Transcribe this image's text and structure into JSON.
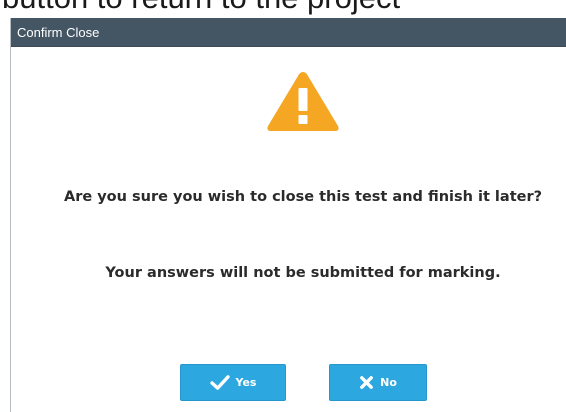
{
  "background_page": {
    "partial_text": "button to return to the project"
  },
  "dialog": {
    "title": "Confirm Close",
    "icon": "warning-icon",
    "message_primary": "Are you sure you wish to close this test and finish it later?",
    "message_secondary": "Your answers will not be submitted for marking.",
    "buttons": {
      "yes": {
        "label": "Yes",
        "icon": "check-icon"
      },
      "no": {
        "label": "No",
        "icon": "x-icon"
      }
    }
  },
  "colors": {
    "titlebar": "#445563",
    "warning": "#f5a623",
    "button": "#2da7df",
    "text": "#2b2b2b"
  }
}
